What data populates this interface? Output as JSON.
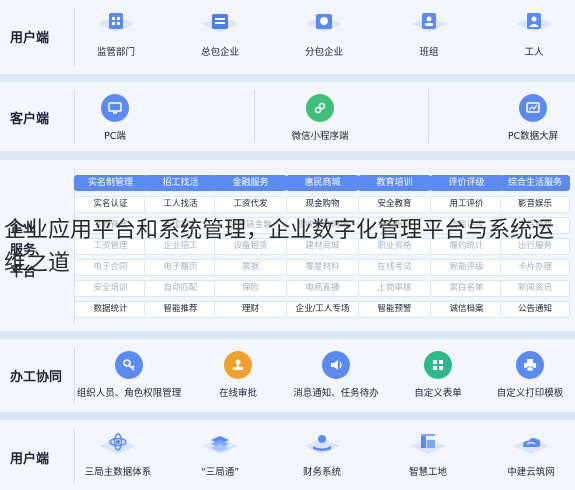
{
  "section_user_top": {
    "label": "用户端",
    "items": [
      {
        "label": "监管部门",
        "icon": "supervision-building-icon"
      },
      {
        "label": "总包企业",
        "icon": "contractor-building-icon"
      },
      {
        "label": "分包企业",
        "icon": "subcontractor-building-icon"
      },
      {
        "label": "班组",
        "icon": "team-badge-icon"
      },
      {
        "label": "工人",
        "icon": "worker-icon"
      }
    ]
  },
  "section_client": {
    "label": "客户端",
    "items": [
      {
        "label": "PC端",
        "icon": "pc-icon"
      },
      {
        "label": "微信小程序端",
        "icon": "mini-program-icon"
      },
      {
        "label": "PC数据大屏",
        "icon": "data-screen-icon"
      }
    ]
  },
  "section_services": {
    "label_line1": "企业",
    "label_line2": "服务",
    "label_line3": "平台",
    "columns": [
      {
        "header": "实名制管理",
        "cells": [
          "实名认证",
          "考勤管理",
          "工资管理",
          "电子合同",
          "安全培训",
          "数据统计"
        ]
      },
      {
        "header": "招工找活",
        "cells": [
          "工人找活",
          "班组招工",
          "企业招工",
          "电子履历",
          "自动匹配",
          "智能推荐"
        ]
      },
      {
        "header": "金融服务",
        "cells": [
          "工资代发",
          "供应链金融",
          "设备租赁",
          "票据",
          "保险",
          "理财"
        ]
      },
      {
        "header": "惠民商城",
        "cells": [
          "现金购物",
          "应收账款购物",
          "建材商城",
          "零星材料",
          "电商直播",
          "企业/工人专场"
        ]
      },
      {
        "header": "教育培训",
        "cells": [
          "安全教育",
          "技能培训",
          "职业资格",
          "在线考试",
          "上岗审核",
          "智能预警"
        ]
      },
      {
        "header": "评价评级",
        "cells": [
          "用工评价",
          "信用评级",
          "履约统计",
          "智能评级",
          "黑白名单",
          "诚信档案"
        ]
      },
      {
        "header": "综合生活服务",
        "cells": [
          "影音娱乐",
          "生活缴费",
          "出行服务",
          "卡片办理",
          "新闻资讯",
          "公告通知"
        ]
      }
    ]
  },
  "section_office": {
    "label": "办工协同",
    "items": [
      {
        "label": "组织人员、角色权限管理",
        "icon": "key-icon"
      },
      {
        "label": "在线审批",
        "icon": "stamp-icon"
      },
      {
        "label": "消息通知、任务待办",
        "icon": "speaker-icon"
      },
      {
        "label": "自定义表单",
        "icon": "grid-form-icon"
      },
      {
        "label": "自定义打印模板",
        "icon": "printer-icon"
      }
    ]
  },
  "section_user_bottom": {
    "label": "用户端",
    "items": [
      {
        "label": "三局主数据体系",
        "icon": "atom-icon"
      },
      {
        "label": "“三局通”",
        "icon": "layers-icon"
      },
      {
        "label": "财务系统",
        "icon": "finance-hand-icon"
      },
      {
        "label": "智慧工地",
        "icon": "smart-site-icon"
      },
      {
        "label": "中建云筑网",
        "icon": "cloud-net-icon"
      }
    ]
  },
  "overlay_caption": "企业应用平台和系统管理，企业数字化管理平台与系统运维之道",
  "colors": {
    "accent_blue": "#5b8af0",
    "accent_light": "#7ea6f6",
    "orange": "#f0a030",
    "green": "#3fbf7a",
    "teal": "#2fb88a"
  }
}
